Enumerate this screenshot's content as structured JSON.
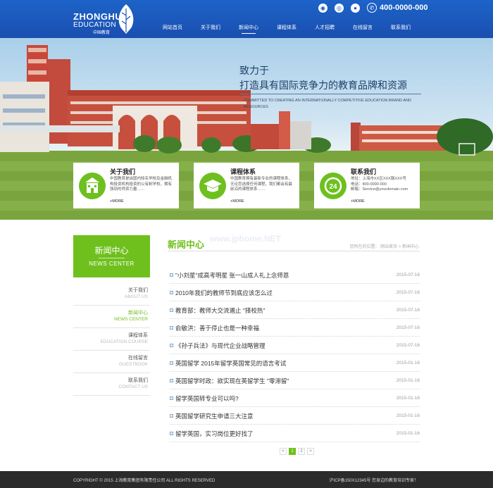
{
  "logo": {
    "line1": "ZHONGHUA",
    "line2": "EDUCATION",
    "cn": "中国教育"
  },
  "header": {
    "phone": "400-0000-000"
  },
  "nav": [
    {
      "label": "网站首页"
    },
    {
      "label": "关于我们"
    },
    {
      "label": "新闻中心",
      "active": true
    },
    {
      "label": "课程体系"
    },
    {
      "label": "人才招聘"
    },
    {
      "label": "在线留言"
    },
    {
      "label": "联系我们"
    }
  ],
  "banner": {
    "slogan_line1": "致力于",
    "slogan_line2": "打造具有国际竞争力的教育品牌和资源",
    "slogan_en": "COMMITTED TO CREATING AN INTERNATIONALLY COMPETITIVE EDUCATION BRAND AND RESOURCES"
  },
  "cards": [
    {
      "title": "关于我们",
      "text": "中国教育是由国内知名学校及金融机构投资机构投资的公有制学校，拥有强劲的师资力量……",
      "more": "+MORE",
      "icon": "school-icon"
    },
    {
      "title": "课程体系",
      "text": "中国教育拥有最新专业的课程体系，无论您选择任何课程，我们都会有最前沿的课程体系……",
      "more": "+MORE",
      "icon": "graduation-cap-icon"
    },
    {
      "title": "联系我们",
      "text": "地址：上海市XX区XXX路XXX号\n电话：400-0000-000\n邮箱：Service@yourdomain.com",
      "more": "+MORE",
      "icon": "24h-icon"
    }
  ],
  "sidebar": {
    "title_cn": "新闻中心",
    "title_en": "NEWS CENTER",
    "items": [
      {
        "cn": "关于我们",
        "en": "ABOUT US"
      },
      {
        "cn": "新闻中心",
        "en": "NEWS CENTER",
        "active": true
      },
      {
        "cn": "课程体系",
        "en": "EDUCATION COURSE"
      },
      {
        "cn": "在线留言",
        "en": "GUESTBOOK"
      },
      {
        "cn": "联系我们",
        "en": "CONTACT US"
      }
    ]
  },
  "main": {
    "title": "新闻中心",
    "watermark": "www.jphome.NET",
    "breadcrumb": "您所在的位置： 网站首页 > 新闻中心",
    "news": [
      {
        "title": "\"小刘星\"成高考明星 张一山成人礼上念师恩",
        "date": "2015-07-16"
      },
      {
        "title": "2010年我们的教师节到底应该怎么过",
        "date": "2015-07-16"
      },
      {
        "title": "教育部：教师大交流遏止 \"择校热\"",
        "date": "2015-07-16"
      },
      {
        "title": "俞敏洪：善于停止也是一种幸福",
        "date": "2015-07-16"
      },
      {
        "title": "《孙子兵法》与现代企业战略管理",
        "date": "2015-07-16"
      },
      {
        "title": "英国留学 2015年留学英国常见的语言考试",
        "date": "2015-01-16"
      },
      {
        "title": "英国留学时政：欲实现在英留学生 \"零滞留\"",
        "date": "2015-01-16"
      },
      {
        "title": "留学英国转专业可以吗?",
        "date": "2015-01-16"
      },
      {
        "title": "英国留学研究生申请三大注意",
        "date": "2015-01-16"
      },
      {
        "title": "留学英国，实习岗位更好找了",
        "date": "2015-01-16"
      }
    ],
    "pager": [
      "<",
      "1",
      "2",
      ">"
    ]
  },
  "footer": {
    "copyright": "COPYRIGHT © 2015 上海教育集团有限责任公司 ALL RIGHTS RESERVED",
    "icp": "沪ICP备150X12345号   您身边的教育培训专家！"
  }
}
